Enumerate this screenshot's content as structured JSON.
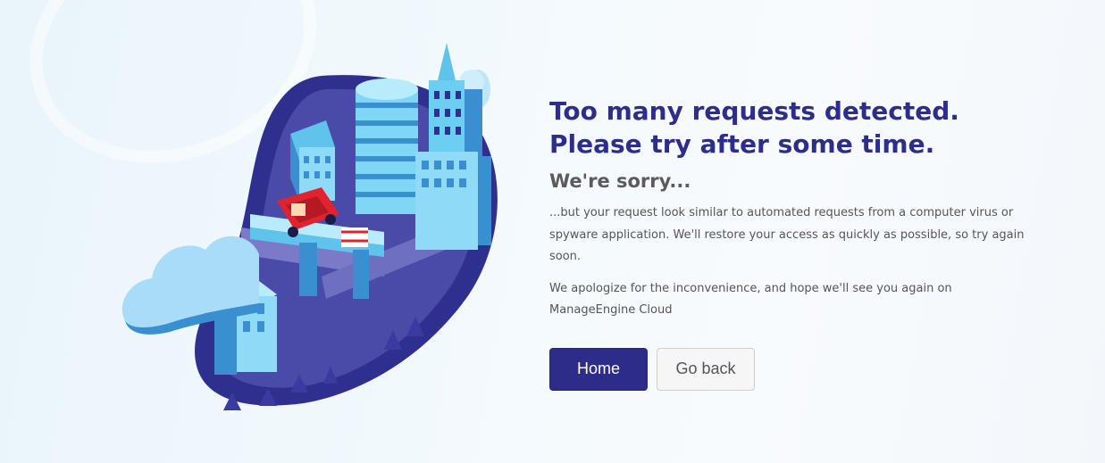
{
  "page": {
    "title": "Too many requests detected. Please try after some time.",
    "subtitle": "We're sorry...",
    "paragraph1": "...but your request look similar to automated requests from a computer virus or spyware application. We'll restore your access as quickly as possible, so try again soon.",
    "paragraph2": "We apologize for the inconvenience, and hope we'll see you again on ManageEngine Cloud"
  },
  "buttons": {
    "home_label": "Home",
    "back_label": "Go back"
  },
  "colors": {
    "title": "#2e2e8a",
    "home_button": "#2d2d89",
    "illustration_dark": "#2f2f8f",
    "illustration_light": "#7fd6f5",
    "car": "#e0232f"
  },
  "illustration": {
    "icon": "city-traffic-illustration"
  }
}
